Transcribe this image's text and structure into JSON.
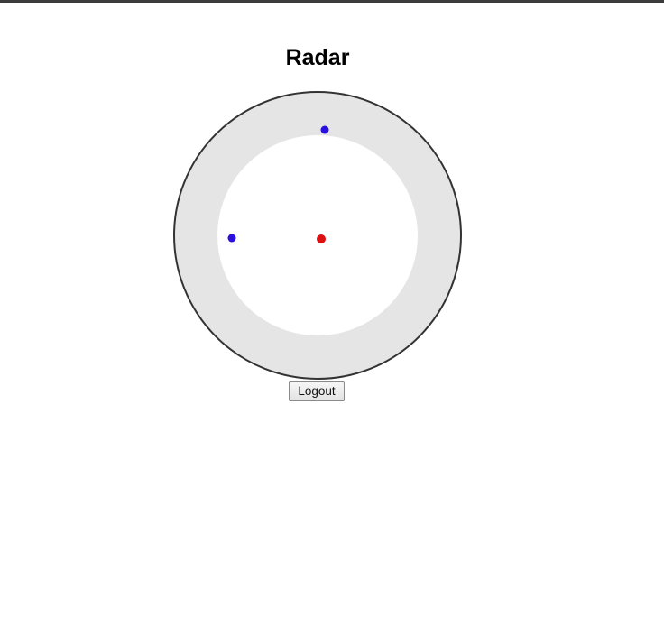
{
  "header": {
    "title": "Radar"
  },
  "radar": {
    "colors": {
      "outer_ring": "#e5e5e5",
      "inner_area": "#ffffff",
      "border": "#333333",
      "self_marker": "#dd1111",
      "contact_marker": "#2a10dd"
    }
  },
  "actions": {
    "logout_label": "Logout"
  }
}
